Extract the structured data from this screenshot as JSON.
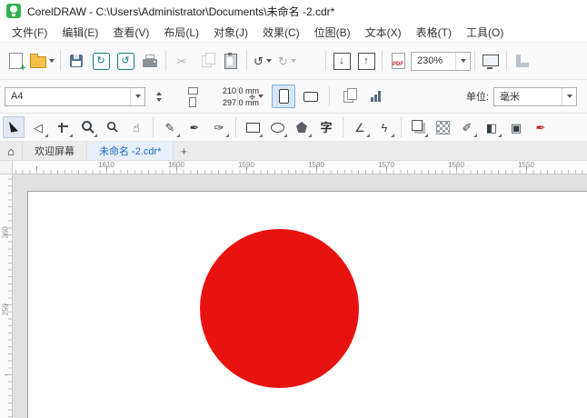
{
  "titlebar": {
    "title": "CorelDRAW - C:\\Users\\Administrator\\Documents\\未命名 -2.cdr*"
  },
  "menu": {
    "items": [
      "文件(F)",
      "编辑(E)",
      "查看(V)",
      "布局(L)",
      "对象(J)",
      "效果(C)",
      "位图(B)",
      "文本(X)",
      "表格(T)",
      "工具(O)"
    ]
  },
  "toolbar": {
    "zoom_value": "230%",
    "pdf_label": "PDF"
  },
  "property_bar": {
    "page_size_value": "A4",
    "page_width": "210.0 mm",
    "page_height": "297.0 mm",
    "units_label": "单位:",
    "units_value": "毫米"
  },
  "toolbox": {
    "text_tool_glyph": "字"
  },
  "tabbar": {
    "welcome_tab": "欢迎屏幕",
    "document_tab": "未命名 -2.cdr*",
    "new_tab": "+"
  },
  "rulers": {
    "horizontal": [
      "1610",
      "1600",
      "1590",
      "1580",
      "1570",
      "1560",
      "1550"
    ],
    "vertical": [
      "260",
      "250"
    ]
  },
  "canvas": {
    "object": "circle",
    "fill": "#e8120f"
  },
  "colors": {
    "active_tab_text": "#1a66c8",
    "logo_green": "#2fb24c",
    "circle_fill": "#e8120f"
  },
  "icons": {
    "plus": "+",
    "undo": "↺",
    "redo": "↻",
    "import_arrow": "↓",
    "export_arrow": "↑",
    "home": "⌂",
    "shape_cursor": "◁",
    "pencil": "✎",
    "pen": "✒",
    "brush": "✑",
    "hand": "☝",
    "angle": "∠",
    "connector": "ϟ",
    "target": "⌖",
    "fill_half": "◧",
    "fill_square": "▣",
    "dropper": "✐",
    "scissors": "✂"
  }
}
